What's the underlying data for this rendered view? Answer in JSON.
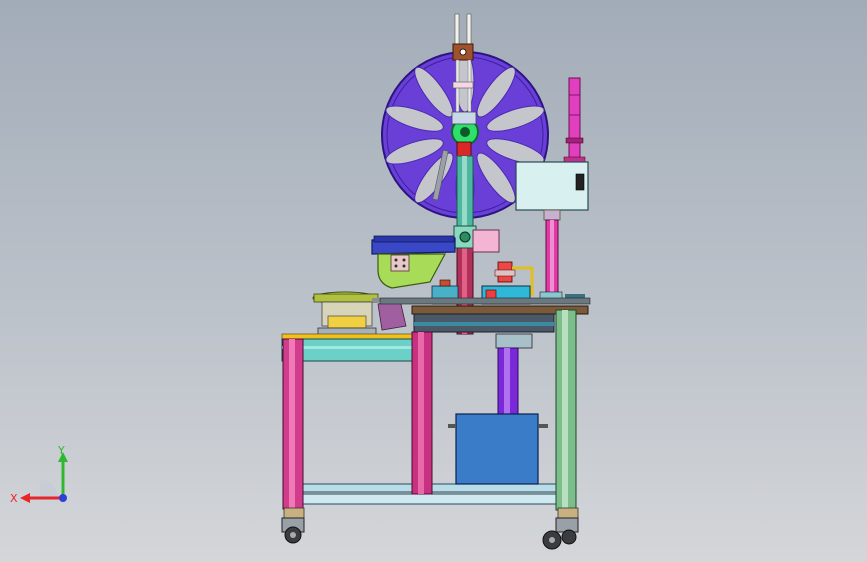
{
  "viewport": {
    "background_top": "#a2acb8",
    "background_bottom": "#d4d6d9"
  },
  "triad": {
    "x_label": "X",
    "y_label": "Y",
    "x_color": "#e8262a",
    "y_color": "#2fb82f",
    "z_color": "#2c3fd6"
  },
  "colors": {
    "reel": "#6a3fd8",
    "reel_rim": "#3a1fa0",
    "leg_magenta": "#d23c8c",
    "leg_green": "#7dbd8c",
    "column_teal": "#4ab8a0",
    "motor_box": "#3a7cc8",
    "tower_light": "#e040c0",
    "table_top": "#7a5a3a",
    "control_box": "#d8f0f0"
  }
}
